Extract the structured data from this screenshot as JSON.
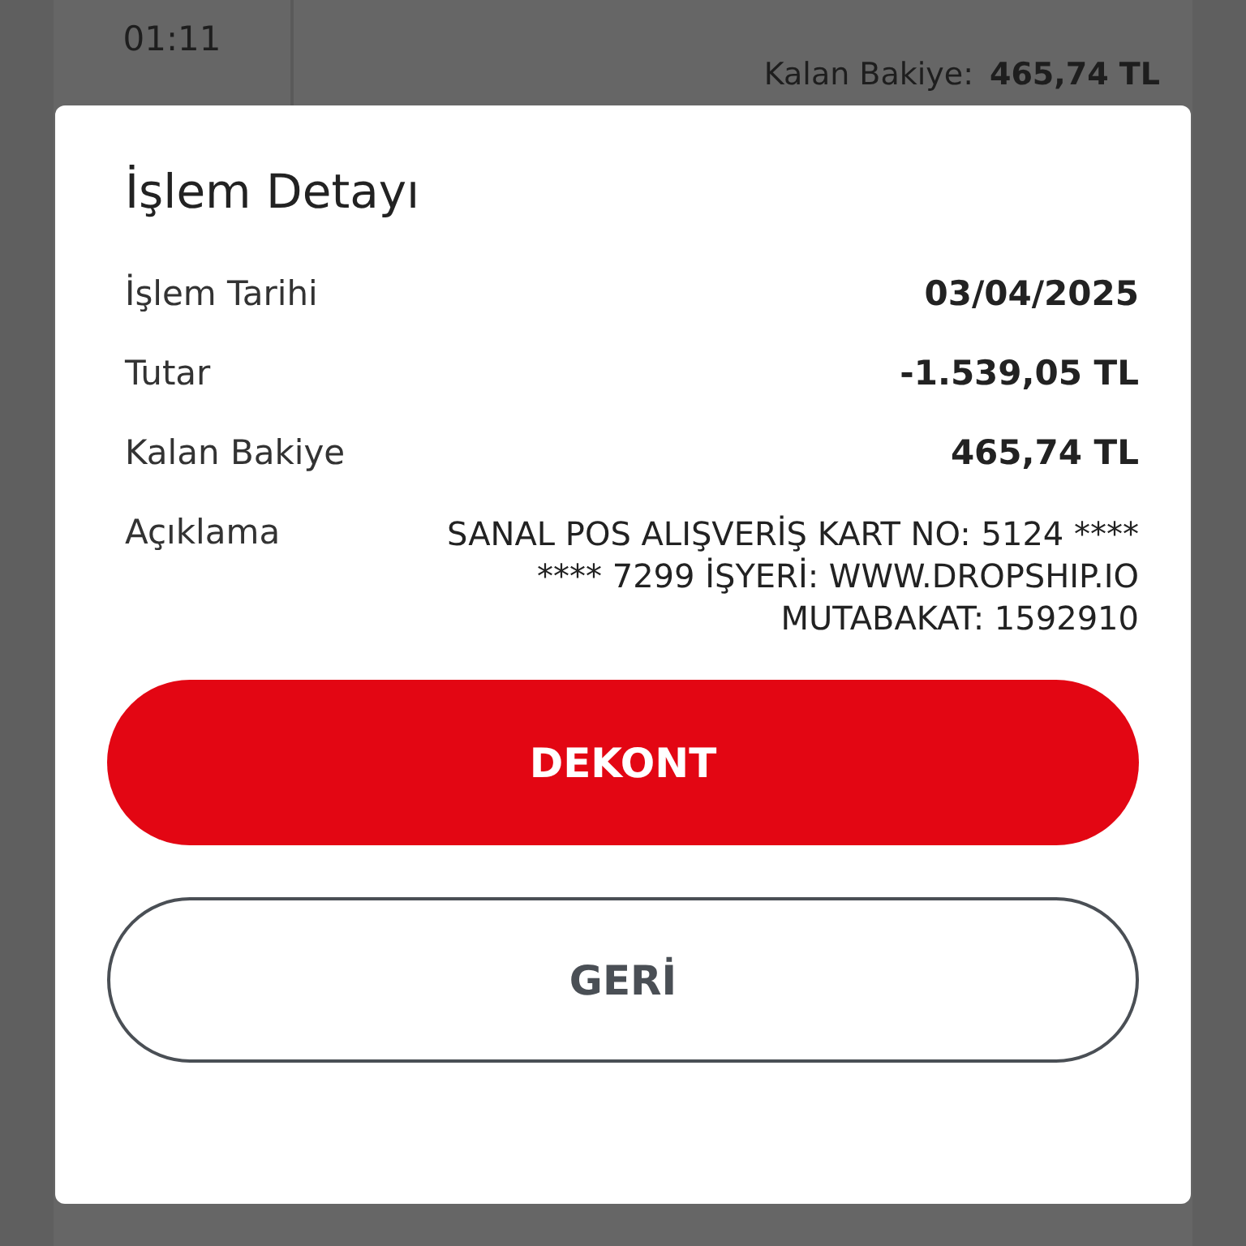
{
  "background": {
    "time": "01:11",
    "balance_label": "Kalan Bakiye:",
    "balance_value": "465,74 TL"
  },
  "dialog": {
    "title": "İşlem Detayı",
    "rows": [
      {
        "label": "İşlem Tarihi",
        "value": "03/04/2025",
        "kind": "bold"
      },
      {
        "label": "Tutar",
        "value": "-1.539,05 TL",
        "kind": "bold"
      },
      {
        "label": "Kalan Bakiye",
        "value": "465,74 TL",
        "kind": "bold"
      },
      {
        "label": "Açıklama",
        "value": "SANAL POS ALIŞVERİŞ KART NO: 5124 **** **** 7299 İŞYERİ: WWW.DROPSHIP.IO MUTABAKAT: 1592910",
        "kind": "plain"
      }
    ],
    "buttons": [
      {
        "label": "DEKONT",
        "kind": "primary"
      },
      {
        "label": "GERİ",
        "kind": "secondary"
      }
    ]
  }
}
